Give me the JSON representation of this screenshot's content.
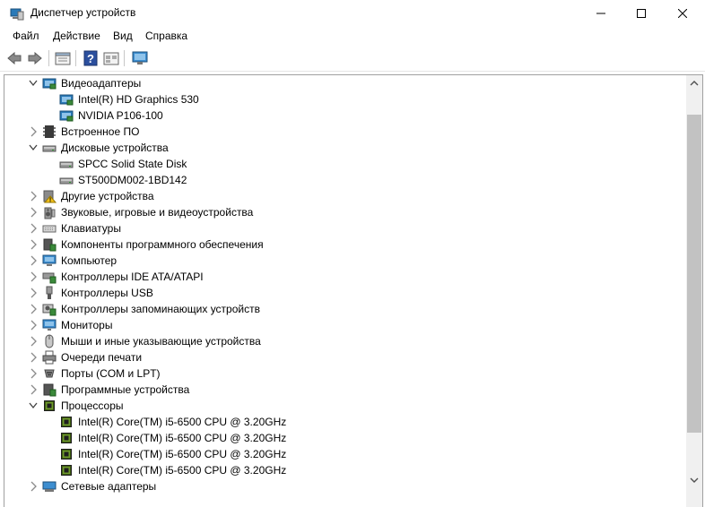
{
  "window": {
    "title": "Диспетчер устройств",
    "minimize": "minimize",
    "maximize": "maximize",
    "close": "close"
  },
  "menu": [
    "Файл",
    "Действие",
    "Вид",
    "Справка"
  ],
  "toolbar": {
    "buttons": [
      "back-arrow-icon",
      "forward-arrow-icon",
      "properties-icon",
      "help-icon",
      "view-icon",
      "monitor-icon"
    ]
  },
  "colors": {
    "accent": "#2a7ab8",
    "chip": "#6f9a2c",
    "scroll_thumb": "#c2c2c2"
  },
  "tree": [
    {
      "label": "Видеоадаптеры",
      "level": 0,
      "state": "expanded",
      "icon": "display-adapter-icon"
    },
    {
      "label": "Intel(R) HD Graphics 530",
      "level": 1,
      "state": "leaf",
      "icon": "display-adapter-icon"
    },
    {
      "label": "NVIDIA P106-100",
      "level": 1,
      "state": "leaf",
      "icon": "display-adapter-icon"
    },
    {
      "label": "Встроенное ПО",
      "level": 0,
      "state": "collapsed",
      "icon": "firmware-icon"
    },
    {
      "label": "Дисковые устройства",
      "level": 0,
      "state": "expanded",
      "icon": "disk-drive-icon"
    },
    {
      "label": "SPCC Solid State Disk",
      "level": 1,
      "state": "leaf",
      "icon": "disk-drive-icon"
    },
    {
      "label": "ST500DM002-1BD142",
      "level": 1,
      "state": "leaf",
      "icon": "disk-drive-icon"
    },
    {
      "label": "Другие устройства",
      "level": 0,
      "state": "collapsed",
      "icon": "unknown-device-icon"
    },
    {
      "label": "Звуковые, игровые и видеоустройства",
      "level": 0,
      "state": "collapsed",
      "icon": "speaker-icon"
    },
    {
      "label": "Клавиатуры",
      "level": 0,
      "state": "collapsed",
      "icon": "keyboard-icon"
    },
    {
      "label": "Компоненты программного обеспечения",
      "level": 0,
      "state": "collapsed",
      "icon": "software-component-icon"
    },
    {
      "label": "Компьютер",
      "level": 0,
      "state": "collapsed",
      "icon": "computer-icon"
    },
    {
      "label": "Контроллеры IDE ATA/ATAPI",
      "level": 0,
      "state": "collapsed",
      "icon": "ide-controller-icon"
    },
    {
      "label": "Контроллеры USB",
      "level": 0,
      "state": "collapsed",
      "icon": "usb-icon"
    },
    {
      "label": "Контроллеры запоминающих устройств",
      "level": 0,
      "state": "collapsed",
      "icon": "storage-controller-icon"
    },
    {
      "label": "Мониторы",
      "level": 0,
      "state": "collapsed",
      "icon": "monitor-icon"
    },
    {
      "label": "Мыши и иные указывающие устройства",
      "level": 0,
      "state": "collapsed",
      "icon": "mouse-icon"
    },
    {
      "label": "Очереди печати",
      "level": 0,
      "state": "collapsed",
      "icon": "printer-icon"
    },
    {
      "label": "Порты (COM и LPT)",
      "level": 0,
      "state": "collapsed",
      "icon": "port-icon"
    },
    {
      "label": "Программные устройства",
      "level": 0,
      "state": "collapsed",
      "icon": "software-device-icon"
    },
    {
      "label": "Процессоры",
      "level": 0,
      "state": "expanded",
      "icon": "processor-icon"
    },
    {
      "label": "Intel(R) Core(TM) i5-6500 CPU @ 3.20GHz",
      "level": 1,
      "state": "leaf",
      "icon": "processor-icon"
    },
    {
      "label": "Intel(R) Core(TM) i5-6500 CPU @ 3.20GHz",
      "level": 1,
      "state": "leaf",
      "icon": "processor-icon"
    },
    {
      "label": "Intel(R) Core(TM) i5-6500 CPU @ 3.20GHz",
      "level": 1,
      "state": "leaf",
      "icon": "processor-icon"
    },
    {
      "label": "Intel(R) Core(TM) i5-6500 CPU @ 3.20GHz",
      "level": 1,
      "state": "leaf",
      "icon": "processor-icon"
    },
    {
      "label": "Сетевые адаптеры",
      "level": 0,
      "state": "collapsed",
      "icon": "network-adapter-icon"
    }
  ],
  "scrollbar": {
    "position_fraction": 0.09,
    "visible_fraction": 0.74
  }
}
